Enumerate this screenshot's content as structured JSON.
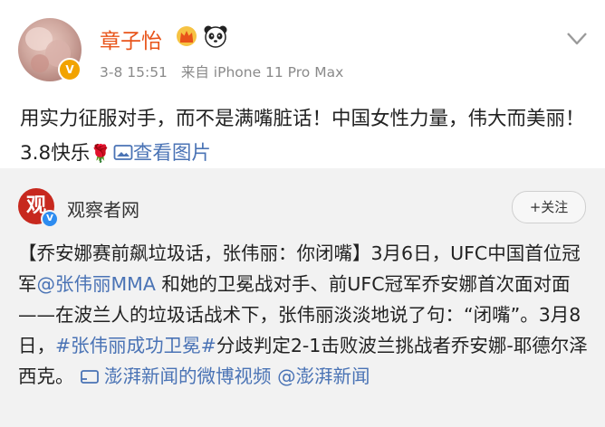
{
  "post": {
    "username": "章子怡",
    "timestamp": "3-8 15:51",
    "source": "来自 iPhone 11 Pro Max",
    "text_main": "用实力征服对手，而不是满嘴脏话！中国女性力量，伟大而美丽！3.8快乐",
    "rose": "🌹",
    "view_image_label": "查看图片",
    "colors": {
      "username": "#e8541a",
      "link": "#4a73b5",
      "verified": "#f2a300"
    }
  },
  "repost": {
    "source_name": "观察者网",
    "source_logo_char": "观",
    "follow_label": "+关注",
    "text_segments": [
      {
        "text": "【乔安娜赛前飙垃圾话，张伟丽：你闭嘴】3月6日，UFC中国首位冠军",
        "link": false
      },
      {
        "text": "@张伟丽MMA",
        "link": true
      },
      {
        "text": " 和她的卫冕战对手、前UFC冠军乔安娜首次面对面——在波兰人的垃圾话战术下，张伟丽淡淡地说了句：“闭嘴”。3月8日，",
        "link": false
      },
      {
        "text": "#张伟丽成功卫冕#",
        "link": true
      },
      {
        "text": "分歧判定2-1击败波兰挑战者乔安娜-耶德尔泽西克。 ",
        "link": false
      },
      {
        "text": "澎湃新闻的微博视频",
        "link": true,
        "icon": "video-icon"
      },
      {
        "text": " ",
        "link": false
      },
      {
        "text": "@澎湃新闻",
        "link": true
      }
    ]
  },
  "icons": [
    "crown-icon",
    "panda-icon",
    "chevron-down-icon",
    "image-icon",
    "video-icon",
    "verified-icon"
  ]
}
